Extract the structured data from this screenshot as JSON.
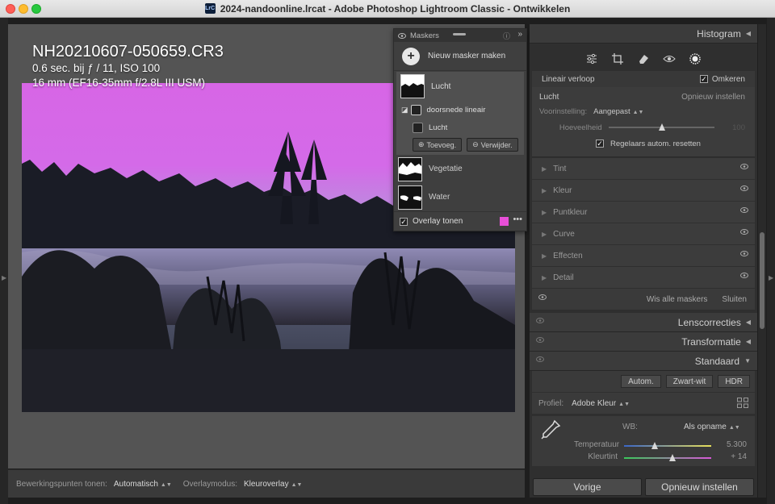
{
  "window": {
    "title": "2024-nandoonline.lrcat - Adobe Photoshop Lightroom Classic - Ontwikkelen",
    "app_badge": "LrC"
  },
  "photo": {
    "filename": "NH20210607-050659.CR3",
    "exposure": "0.6 sec. bij ƒ / 11, ISO 100",
    "lens": "16 mm (EF16-35mm f/2.8L III USM)"
  },
  "toolbar": {
    "edit_points_label": "Bewerkingspunten tonen:",
    "edit_points_value": "Automatisch",
    "overlay_mode_label": "Overlaymodus:",
    "overlay_mode_value": "Kleuroverlay"
  },
  "masks": {
    "title": "Maskers",
    "new_mask": "Nieuw masker maken",
    "group_name": "Lucht",
    "component_name": "doorsnede lineair",
    "sub_name": "Lucht",
    "add_button": "Toevoeg.",
    "remove_button": "Verwijder.",
    "other_masks": [
      "Vegetatie",
      "Water"
    ],
    "overlay_label": "Overlay tonen",
    "overlay_color": "#e84fd8"
  },
  "right": {
    "histogram": "Histogram",
    "linear": {
      "label": "Lineair verloop",
      "invert": "Omkeren"
    },
    "lucht": {
      "title": "Lucht",
      "reset": "Opnieuw instellen",
      "preset_label": "Voorinstelling:",
      "preset_value": "Aangepast",
      "amount_label": "Hoeveelheid",
      "amount_value": "100",
      "auto_reset": "Regelaars autom. resetten"
    },
    "sections": [
      "Tint",
      "Kleur",
      "Puntkleur",
      "Curve",
      "Effecten",
      "Detail"
    ],
    "clear_all": "Wis alle maskers",
    "close": "Sluiten",
    "lens": "Lenscorrecties",
    "transform": "Transformatie",
    "basic": "Standaard",
    "basic_btns": [
      "Autom.",
      "Zwart-wit",
      "HDR"
    ],
    "profile_label": "Profiel:",
    "profile_value": "Adobe Kleur",
    "wb_label": "WB:",
    "wb_value": "Als opname",
    "temp_label": "Temperatuur",
    "temp_value": "5.300",
    "tint_label": "Kleurtint",
    "tint_value": "+ 14",
    "prev_button": "Vorige",
    "reset_button": "Opnieuw instellen"
  }
}
